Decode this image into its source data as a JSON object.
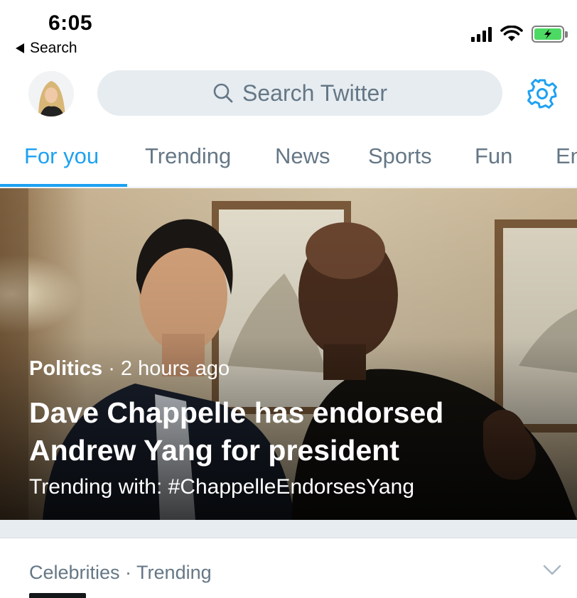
{
  "status_bar": {
    "time": "6:05",
    "back_label": "Search",
    "battery_color": "#4cd964"
  },
  "header": {
    "search_placeholder": "Search Twitter",
    "icons": [
      "avatar",
      "search-icon",
      "gear-icon"
    ],
    "accent_color": "#1da1f2"
  },
  "tabs": [
    {
      "label": "For you",
      "active": true
    },
    {
      "label": "Trending",
      "active": false
    },
    {
      "label": "News",
      "active": false
    },
    {
      "label": "Sports",
      "active": false
    },
    {
      "label": "Fun",
      "active": false
    },
    {
      "label": "En",
      "active": false
    }
  ],
  "hero": {
    "category": "Politics",
    "time": " · 2 hours ago",
    "headline": "Dave Chappelle has endorsed Andrew Yang for president",
    "trending_with": "Trending with: #ChappelleEndorsesYang"
  },
  "next_item": {
    "meta": "Celebrities · Trending"
  }
}
